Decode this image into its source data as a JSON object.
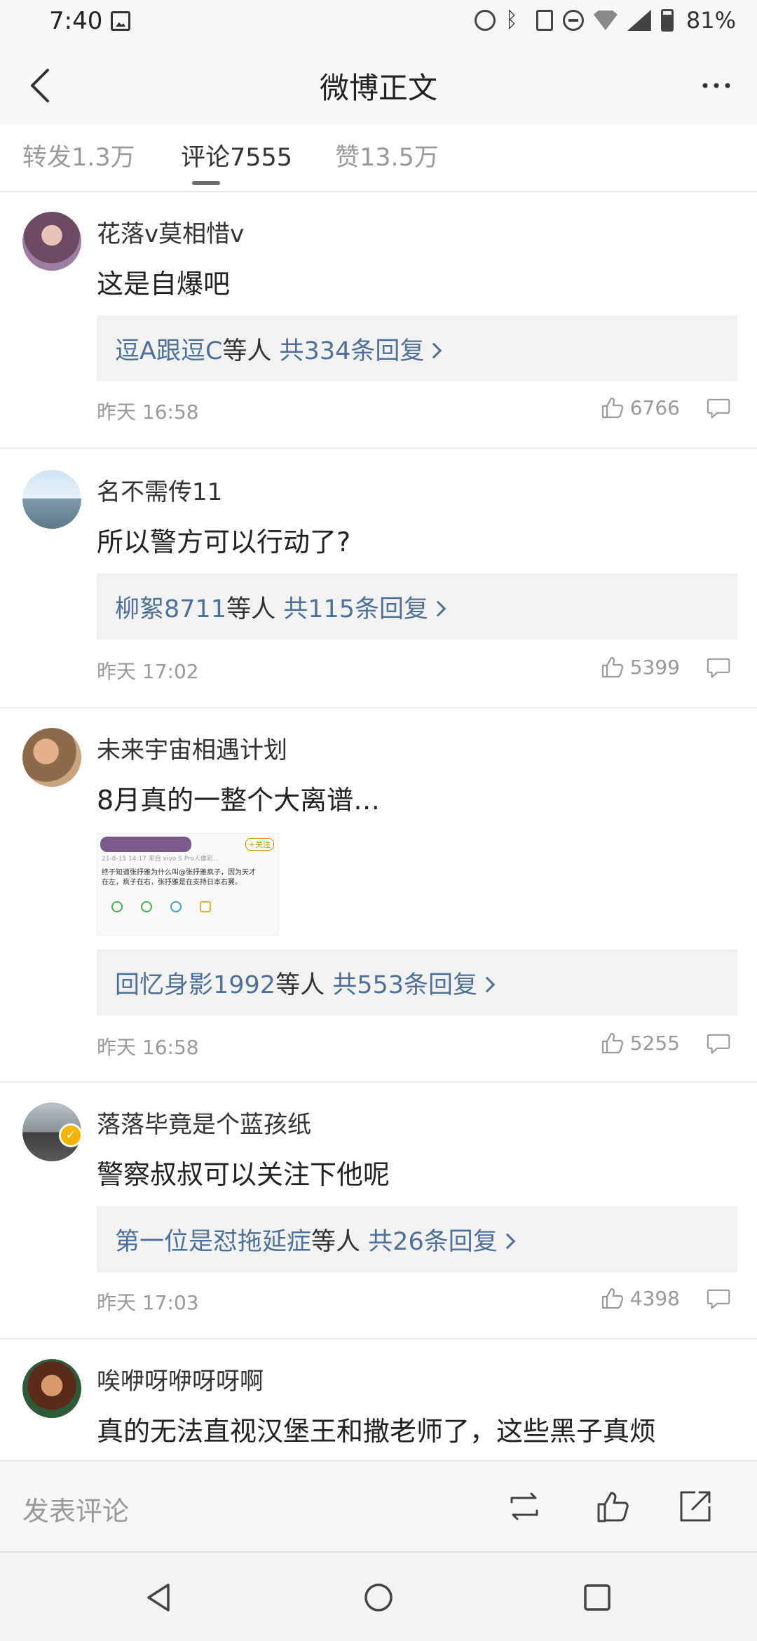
{
  "status_bar": {
    "time": "7:40",
    "battery": "81%"
  },
  "header": {
    "title": "微博正文"
  },
  "tabs": [
    {
      "label": "转发1.3万",
      "active": false
    },
    {
      "label": "评论7555",
      "active": true
    },
    {
      "label": "赞13.5万",
      "active": false
    }
  ],
  "comments": [
    {
      "username": "花落v莫相惜v",
      "text": "这是自爆吧",
      "reply_users": "逗A跟逗C",
      "reply_etc": "等人",
      "reply_count": "共334条回复",
      "time": "昨天 16:58",
      "likes": "6766"
    },
    {
      "username": "名不需传11",
      "text": "所以警方可以行动了?",
      "reply_users": "柳絮8711",
      "reply_etc": "等人",
      "reply_count": "共115条回复",
      "time": "昨天 17:02",
      "likes": "5399"
    },
    {
      "username": "未来宇宙相遇计划",
      "text": "8月真的一整个大离谱…",
      "reply_users": "回忆身影1992",
      "reply_etc": "等人",
      "reply_count": "共553条回复",
      "time": "昨天 16:58",
      "likes": "5255",
      "image": {
        "follow_label": "+关注",
        "line1": "21-8-15 14:17  来自 vivo S Pro人像彩...",
        "line2": "终于知道张抒雅为什么叫@张抒雅疯子，因为天才",
        "line3": "在左，疯子在右，张抒雅是在支持日本右翼。"
      }
    },
    {
      "username": "落落毕竟是个蓝孩纸",
      "text": "警察叔叔可以关注下他呢",
      "reply_users": "第一位是怼拖延症",
      "reply_etc": "等人",
      "reply_count": "共26条回复",
      "time": "昨天 17:03",
      "likes": "4398",
      "verified": true
    },
    {
      "username": "唉咿呀咿呀呀啊",
      "text": "真的无法直视汉堡王和撒老师了，这些黑子真烦"
    }
  ],
  "bottom_bar": {
    "input_placeholder": "发表评论"
  },
  "colors": {
    "link_blue": "#50709a",
    "verified_badge": "#f3b400",
    "muted_text": "#999999"
  }
}
